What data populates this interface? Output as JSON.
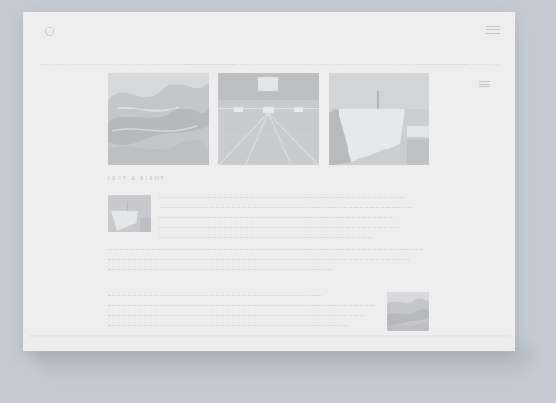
{
  "header": {
    "logo_icon": "circle-logo-icon",
    "menu_icon": "hamburger-menu-icon"
  },
  "gallery": {
    "images": [
      "waves-photo",
      "corridor-photo",
      "ship-bow-photo"
    ]
  },
  "section": {
    "heading": "LEFT & RIGHT"
  },
  "content": {
    "left_image": "ship-thumbnail",
    "right_image": "waves-thumbnail"
  },
  "colors": {
    "background": "#c7ccd3",
    "window": "#eeeeee"
  }
}
